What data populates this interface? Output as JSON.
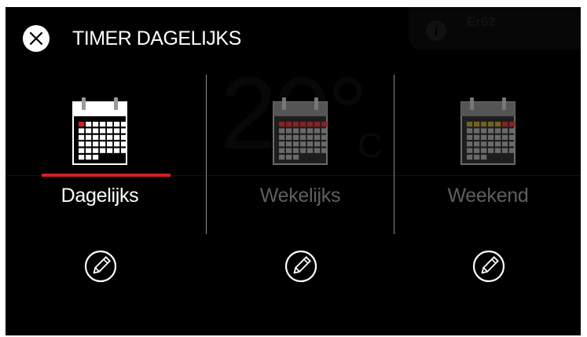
{
  "header": {
    "title": "TIMER DAGELIJKS",
    "close_icon": "close-icon"
  },
  "background": {
    "info_icon": "info-icon",
    "info_glyph": "i",
    "error_code": "Er62",
    "temperature": "20",
    "degree_symbol": "°",
    "unit": "C"
  },
  "options": [
    {
      "label": "Dagelijks",
      "icon": "calendar-icon",
      "selected": true,
      "color": "#ffffff",
      "accent": "#d51f22"
    },
    {
      "label": "Wekelijks",
      "icon": "calendar-icon",
      "selected": false,
      "color": "#5f5f5f",
      "accent": "#8a2222"
    },
    {
      "label": "Weekend",
      "icon": "calendar-icon",
      "selected": false,
      "color": "#5f5f5f",
      "accent": "#8a2222"
    }
  ],
  "edit_icon": "pencil-icon",
  "colors": {
    "background": "#000000",
    "text": "#ffffff",
    "dimmed": "#5f5f5f",
    "selection": "#d51f22"
  }
}
